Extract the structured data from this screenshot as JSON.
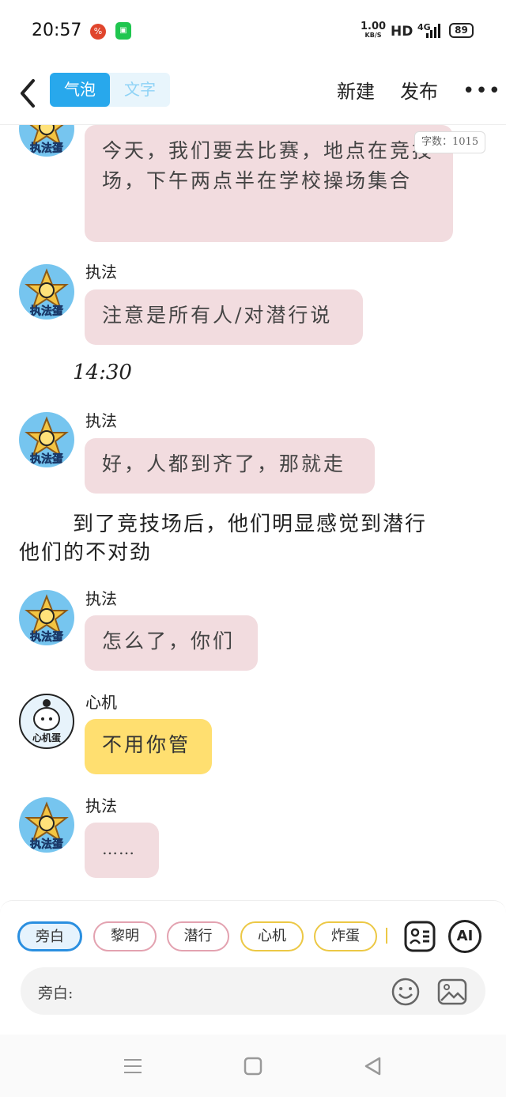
{
  "status": {
    "time": "20:57",
    "app1_glyph": "%",
    "app2_glyph": "▣",
    "net_speed": "1.00",
    "net_unit": "KB/S",
    "hd": "HD",
    "net_type": "4G",
    "battery": "89"
  },
  "header": {
    "tab_bubble": "气泡",
    "tab_text": "文字",
    "new_label": "新建",
    "publish_label": "发布",
    "more": "•••"
  },
  "chat": {
    "word_count": "字数：1015",
    "messages": [
      {
        "avatar_label": "执法蛋",
        "text": "今天，我们要去比赛，地点在竞技场，下午两点半在学校操场集合"
      },
      {
        "name": "执法",
        "avatar_label": "执法蛋",
        "text": "注意是所有人/对潜行说"
      },
      {
        "timestamp": "14:30"
      },
      {
        "name": "执法",
        "avatar_label": "执法蛋",
        "text": "好，人都到齐了，那就走"
      },
      {
        "narration_1": "到了竞技场后，他们明显感觉到潜行",
        "narration_2": "他们的不对劲"
      },
      {
        "name": "执法",
        "avatar_label": "执法蛋",
        "text": "怎么了，你们"
      },
      {
        "name": "心机",
        "avatar_label": "心机蛋",
        "text": "不用你管"
      },
      {
        "name": "执法",
        "avatar_label": "执法蛋",
        "text": "……"
      }
    ]
  },
  "roles": [
    {
      "label": "旁白"
    },
    {
      "label": "黎明"
    },
    {
      "label": "潜行"
    },
    {
      "label": "心机"
    },
    {
      "label": "炸蛋"
    }
  ],
  "input": {
    "label": "旁白:",
    "ai_label": "AI"
  },
  "colors": {
    "accent": "#28a8ec",
    "pink_bubble": "#f2dcdf",
    "yellow_bubble": "#ffdf70"
  }
}
